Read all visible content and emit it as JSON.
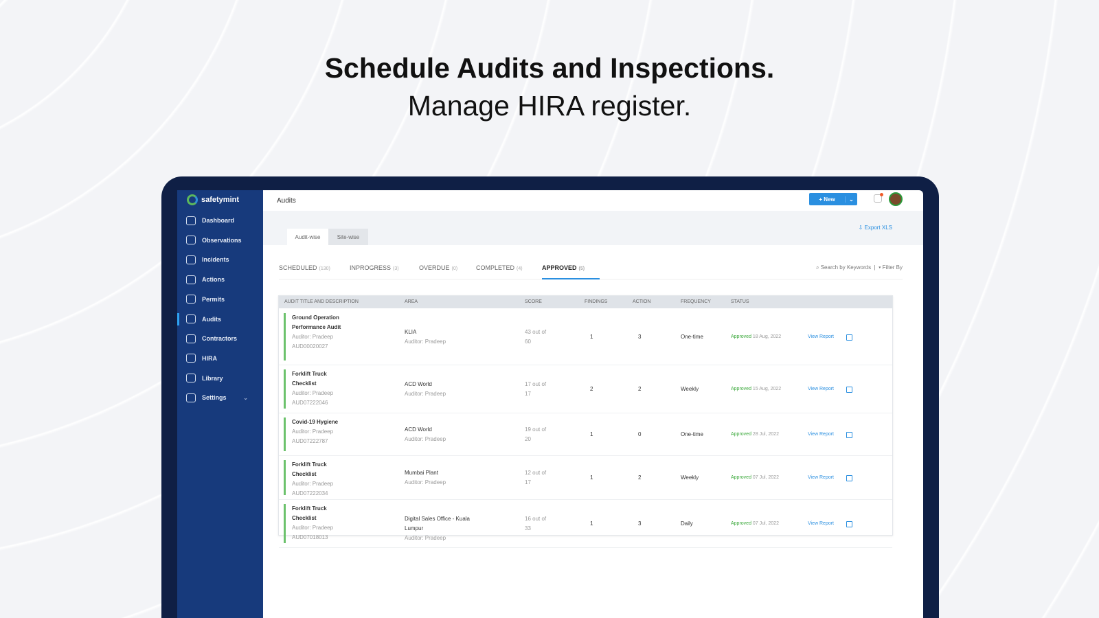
{
  "hero": {
    "line1": "Schedule Audits and Inspections.",
    "line2": "Manage HIRA register."
  },
  "brand": {
    "name": "safetymint"
  },
  "sidebar": {
    "items": [
      {
        "label": "Dashboard",
        "icon": "dashboard-icon"
      },
      {
        "label": "Observations",
        "icon": "observations-icon"
      },
      {
        "label": "Incidents",
        "icon": "incidents-icon"
      },
      {
        "label": "Actions",
        "icon": "actions-icon"
      },
      {
        "label": "Permits",
        "icon": "permits-icon"
      },
      {
        "label": "Audits",
        "icon": "audits-icon",
        "active": true
      },
      {
        "label": "Contractors",
        "icon": "contractors-icon"
      },
      {
        "label": "HIRA",
        "icon": "hira-icon"
      },
      {
        "label": "Library",
        "icon": "library-icon"
      },
      {
        "label": "Settings",
        "icon": "settings-icon"
      }
    ]
  },
  "header": {
    "title": "Audits",
    "new_label": "+ New",
    "new_dropdown": "⌄"
  },
  "view_tabs": {
    "audit_wise": "Audit-wise",
    "site_wise": "Site-wise"
  },
  "export_label": "Export XLS",
  "status_tabs": [
    {
      "label": "SCHEDULED",
      "count": "(130)"
    },
    {
      "label": "INPROGRESS",
      "count": "(3)"
    },
    {
      "label": "OVERDUE",
      "count": "(0)"
    },
    {
      "label": "COMPLETED",
      "count": "(4)"
    },
    {
      "label": "APPROVED",
      "count": "(5)"
    }
  ],
  "search_label": "Search by Keywords",
  "filter_label": "Filter By",
  "table": {
    "headers": [
      "AUDIT TITLE AND DESCRIPTION",
      "AREA",
      "SCORE",
      "FINDINGS",
      "ACTION",
      "FREQUENCY",
      "STATUS"
    ],
    "rows": [
      {
        "title": "Ground Operation Performance Audit",
        "auditor": "Auditor: Pradeep",
        "id": "AUD00020027",
        "area": "KLIA",
        "area_auditor": "Auditor: Pradeep",
        "score": "43 out of 60",
        "findings": "1",
        "action": "3",
        "frequency": "One-time",
        "status": "Approved",
        "date": "18 Aug, 2022",
        "link": "View Report"
      },
      {
        "title": "Forklift Truck Checklist",
        "auditor": "Auditor: Pradeep",
        "id": "AUD07222046",
        "area": "ACD World",
        "area_auditor": "Auditor: Pradeep",
        "score": "17 out of 17",
        "findings": "2",
        "action": "2",
        "frequency": "Weekly",
        "status": "Approved",
        "date": "15 Aug, 2022",
        "link": "View Report"
      },
      {
        "title": "Covid-19 Hygiene",
        "auditor": "Auditor: Pradeep",
        "id": "AUD07222787",
        "area": "ACD World",
        "area_auditor": "Auditor: Pradeep",
        "score": "19 out of 20",
        "findings": "1",
        "action": "0",
        "frequency": "One-time",
        "status": "Approved",
        "date": "28 Jul, 2022",
        "link": "View Report"
      },
      {
        "title": "Forklift Truck Checklist",
        "auditor": "Auditor: Pradeep",
        "id": "AUD07222034",
        "area": "Mumbai Plant",
        "area_auditor": "Auditor: Pradeep",
        "score": "12 out of 17",
        "findings": "1",
        "action": "2",
        "frequency": "Weekly",
        "status": "Approved",
        "date": "07 Jul, 2022",
        "link": "View Report"
      },
      {
        "title": "Forklift Truck Checklist",
        "auditor": "Auditor: Pradeep",
        "id": "AUD07018013",
        "area": "Digital Sales Office - Kuala Lumpur",
        "area_auditor": "Auditor: Pradeep",
        "score": "16 out of 33",
        "findings": "1",
        "action": "3",
        "frequency": "Daily",
        "status": "Approved",
        "date": "07 Jul, 2022",
        "link": "View Report"
      }
    ]
  }
}
